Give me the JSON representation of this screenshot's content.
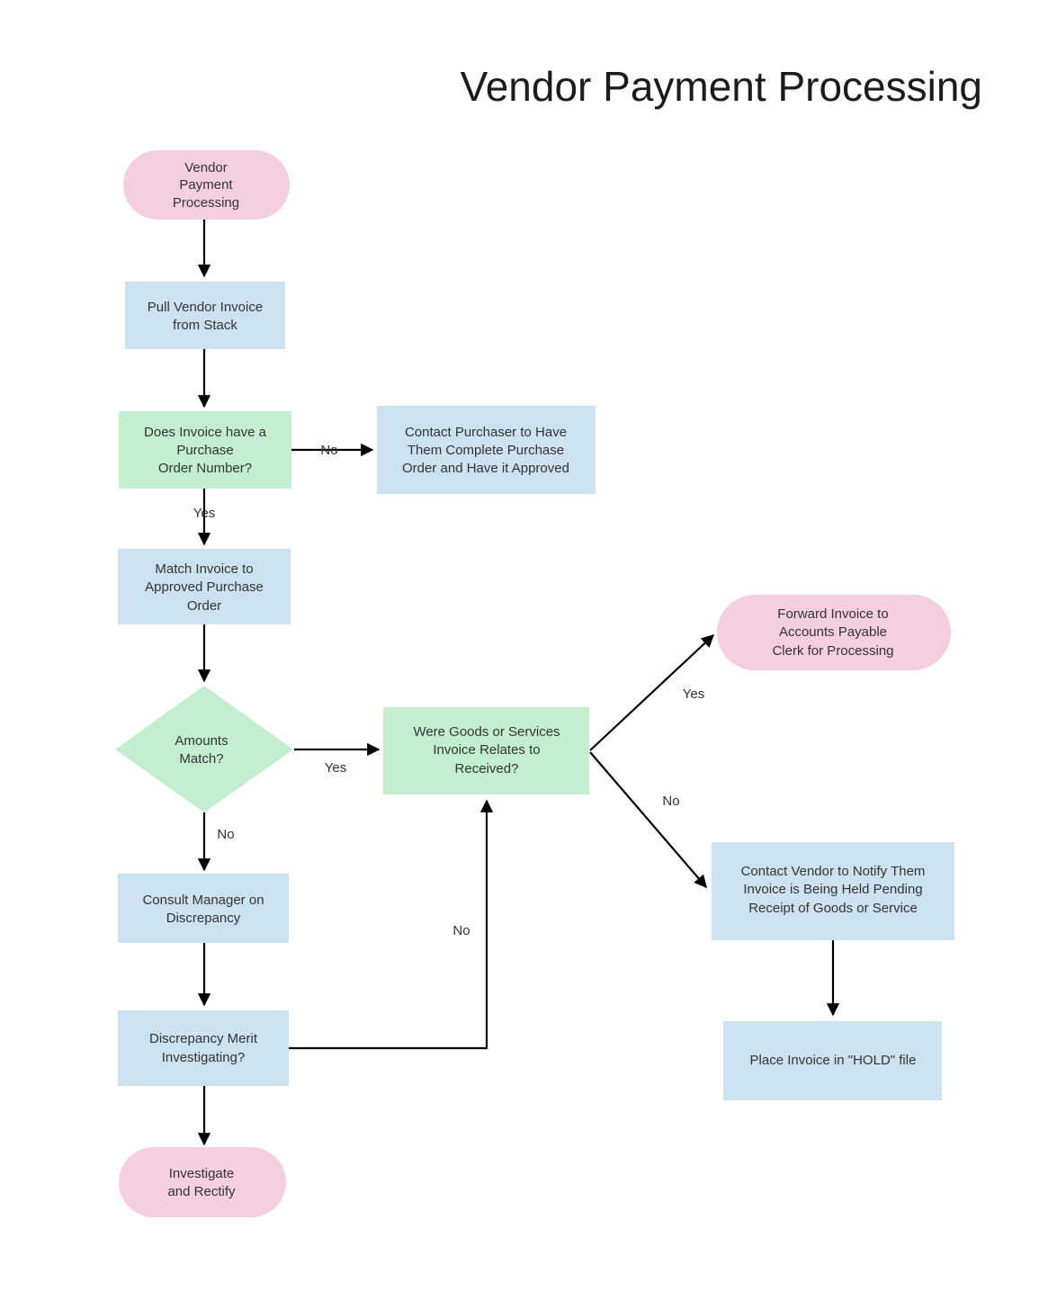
{
  "title": "Vendor Payment Processing",
  "colors": {
    "start_end_fill": "#f5cfe0",
    "process_fill": "#cce2f0",
    "decision_fill": "#c3efd0",
    "edge_stroke": "#000000",
    "text": "#333333",
    "title_text": "#1c1c1c",
    "background": "#ffffff"
  },
  "nodes": [
    {
      "id": "start",
      "shape": "stadium",
      "fill_key": "start_end_fill",
      "lines": [
        "Vendor",
        "Payment",
        "Processing"
      ]
    },
    {
      "id": "pull_invoice",
      "shape": "rect",
      "fill_key": "process_fill",
      "lines": [
        "Pull Vendor Invoice",
        "from Stack"
      ]
    },
    {
      "id": "has_po",
      "shape": "rect",
      "fill_key": "decision_fill",
      "lines": [
        "Does Invoice have a",
        "Purchase",
        "Order Number?"
      ]
    },
    {
      "id": "contact_purchaser",
      "shape": "rect",
      "fill_key": "process_fill",
      "lines": [
        "Contact Purchaser to Have",
        "Them Complete  Purchase",
        "Order and Have it Approved"
      ]
    },
    {
      "id": "match_invoice",
      "shape": "rect",
      "fill_key": "process_fill",
      "lines": [
        "Match Invoice to",
        "Approved Purchase",
        "Order"
      ]
    },
    {
      "id": "amounts_match",
      "shape": "diamond",
      "fill_key": "decision_fill",
      "lines": [
        "Amounts",
        "Match?"
      ]
    },
    {
      "id": "goods_received",
      "shape": "rect",
      "fill_key": "decision_fill",
      "lines": [
        "Were Goods or Services",
        "Invoice Relates to",
        "Received?"
      ]
    },
    {
      "id": "forward_invoice",
      "shape": "stadium",
      "fill_key": "start_end_fill",
      "lines": [
        "Forward Invoice to",
        "Accounts Payable",
        "Clerk for Processing"
      ]
    },
    {
      "id": "contact_vendor",
      "shape": "rect",
      "fill_key": "process_fill",
      "lines": [
        "Contact Vendor to Notify Them",
        "Invoice is Being Held Pending",
        "Receipt of Goods or Service"
      ]
    },
    {
      "id": "place_hold",
      "shape": "rect",
      "fill_key": "process_fill",
      "lines": [
        "Place Invoice in \"HOLD\" file"
      ]
    },
    {
      "id": "consult_manager",
      "shape": "rect",
      "fill_key": "process_fill",
      "lines": [
        "Consult Manager on",
        "Discrepancy"
      ]
    },
    {
      "id": "merit_investigating",
      "shape": "rect",
      "fill_key": "process_fill",
      "lines": [
        "Discrepancy Merit",
        "Investigating?"
      ]
    },
    {
      "id": "investigate_rectify",
      "shape": "stadium",
      "fill_key": "start_end_fill",
      "lines": [
        "Investigate",
        "and Rectify"
      ]
    }
  ],
  "edge_labels": {
    "has_po_no": "No",
    "has_po_yes": "Yes",
    "amounts_match_yes": "Yes",
    "amounts_match_no": "No",
    "goods_received_yes": "Yes",
    "goods_received_no": "No",
    "merit_no": "No"
  },
  "node_text": {
    "start": {
      "l0": "Vendor",
      "l1": "Payment",
      "l2": "Processing"
    },
    "pull_invoice": {
      "l0": "Pull Vendor Invoice",
      "l1": "from Stack"
    },
    "has_po": {
      "l0": "Does Invoice have a",
      "l1": "Purchase",
      "l2": "Order Number?"
    },
    "contact_purchaser": {
      "l0": "Contact Purchaser to Have",
      "l1": "Them Complete  Purchase",
      "l2": "Order and Have it Approved"
    },
    "match_invoice": {
      "l0": "Match Invoice to",
      "l1": "Approved Purchase",
      "l2": "Order"
    },
    "amounts_match": {
      "l0": "Amounts",
      "l1": "Match?"
    },
    "goods_received": {
      "l0": "Were Goods or Services",
      "l1": "Invoice Relates to",
      "l2": "Received?"
    },
    "forward_invoice": {
      "l0": "Forward Invoice to",
      "l1": "Accounts Payable",
      "l2": "Clerk for Processing"
    },
    "contact_vendor": {
      "l0": "Contact Vendor to Notify Them",
      "l1": "Invoice is Being Held Pending",
      "l2": "Receipt of Goods or Service"
    },
    "place_hold": {
      "l0": "Place Invoice in \"HOLD\" file"
    },
    "consult_manager": {
      "l0": "Consult Manager on",
      "l1": "Discrepancy"
    },
    "merit_investigating": {
      "l0": "Discrepancy Merit",
      "l1": "Investigating?"
    },
    "investigate_rectify": {
      "l0": "Investigate",
      "l1": "and Rectify"
    }
  }
}
